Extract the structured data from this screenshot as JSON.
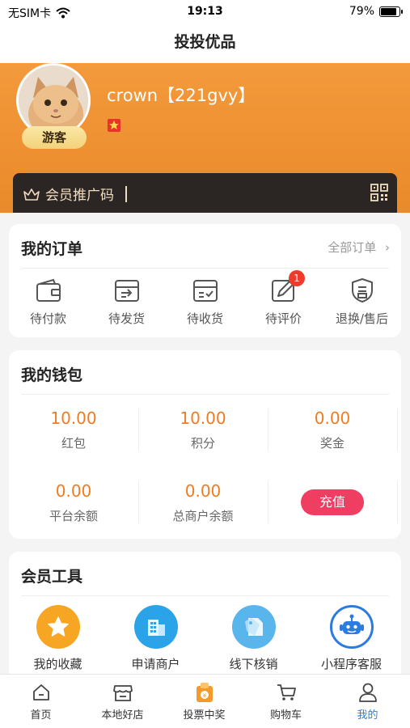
{
  "status_bar": {
    "carrier": "无SIM卡",
    "time": "19:13",
    "battery": "79%"
  },
  "nav": {
    "title": "投投优品"
  },
  "profile": {
    "username": "crown【221gvy】",
    "role_badge": "游客"
  },
  "promo": {
    "label": "会员推广码"
  },
  "orders": {
    "title": "我的订单",
    "all_label": "全部订单",
    "items": [
      {
        "label": "待付款",
        "icon": "wallet-icon"
      },
      {
        "label": "待发货",
        "icon": "ship-icon"
      },
      {
        "label": "待收货",
        "icon": "receive-icon"
      },
      {
        "label": "待评价",
        "icon": "review-icon",
        "badge": "1"
      },
      {
        "label": "退换/售后",
        "icon": "after-sale-icon"
      }
    ]
  },
  "wallet": {
    "title": "我的钱包",
    "cells": [
      {
        "value": "10.00",
        "label": "红包"
      },
      {
        "value": "10.00",
        "label": "积分"
      },
      {
        "value": "0.00",
        "label": "奖金"
      },
      {
        "value": "0.00",
        "label": "平台余额"
      },
      {
        "value": "0.00",
        "label": "总商户余额"
      }
    ],
    "recharge_label": "充值"
  },
  "tools": {
    "title": "会员工具",
    "items": [
      {
        "label": "我的收藏",
        "icon": "star-icon",
        "color": "#f6a623"
      },
      {
        "label": "申请商户",
        "icon": "building-icon",
        "color": "#2aa3e8"
      },
      {
        "label": "线下核销",
        "icon": "tag-icon",
        "color": "#59b6ec"
      },
      {
        "label": "小程序客服",
        "icon": "robot-icon",
        "color": "#2b7be0"
      }
    ]
  },
  "tabbar": {
    "items": [
      {
        "label": "首页",
        "icon": "home-icon"
      },
      {
        "label": "本地好店",
        "icon": "store-icon"
      },
      {
        "label": "投票中奖",
        "icon": "vote-icon"
      },
      {
        "label": "购物车",
        "icon": "cart-icon"
      },
      {
        "label": "我的",
        "icon": "user-icon",
        "active": true
      }
    ]
  },
  "colors": {
    "accent": "#f39a3c",
    "value": "#f07c22",
    "recharge": "#ef3e62",
    "tab_active": "#2a7de1"
  }
}
